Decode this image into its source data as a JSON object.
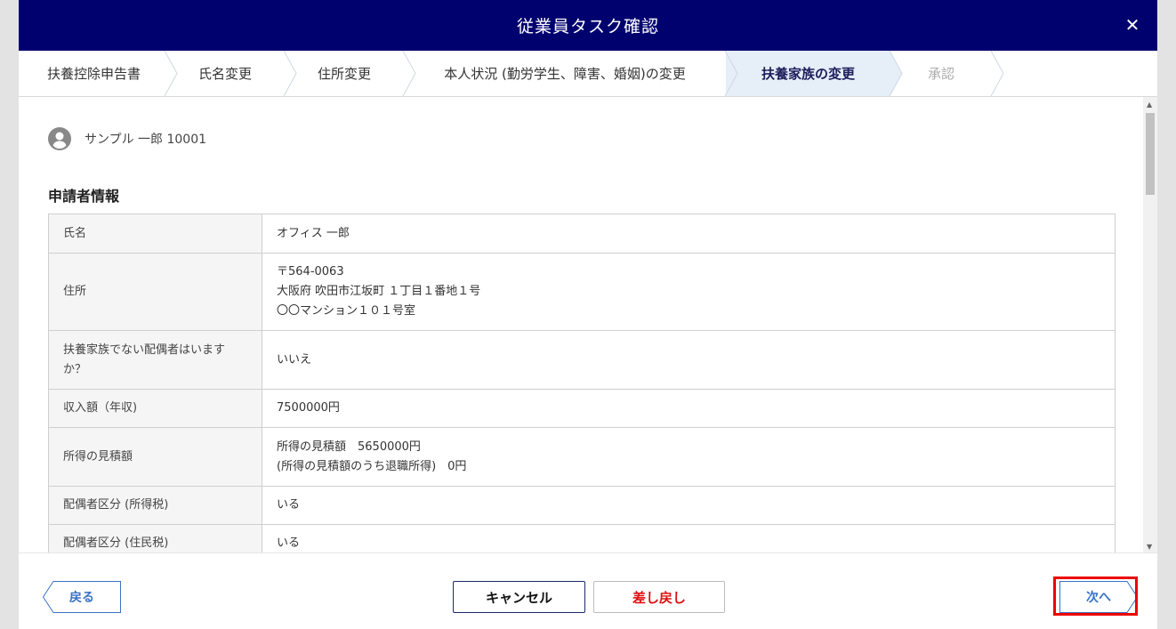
{
  "header": {
    "title": "従業員タスク確認",
    "close_glyph": "✕"
  },
  "steps": [
    {
      "label": "扶養控除申告書",
      "state": "done"
    },
    {
      "label": "氏名変更",
      "state": "done"
    },
    {
      "label": "住所変更",
      "state": "done"
    },
    {
      "label": "本人状況 (勤労学生、障害、婚姻)の変更",
      "state": "done"
    },
    {
      "label": "扶養家族の変更",
      "state": "active"
    },
    {
      "label": "承認",
      "state": "disabled"
    }
  ],
  "user": {
    "name": "サンプル 一郎 10001",
    "icon": "account-circle-icon"
  },
  "section_title": "申請者情報",
  "rows": [
    {
      "key": "氏名",
      "lines": [
        "オフィス 一郎"
      ]
    },
    {
      "key": "住所",
      "lines": [
        "〒564-0063",
        "大阪府 吹田市江坂町 １丁目１番地１号",
        "〇〇マンション１０１号室"
      ]
    },
    {
      "key_lines": [
        "扶養家族でない配偶者はいます",
        "か？"
      ],
      "lines": [
        "いいえ"
      ]
    },
    {
      "key": "収入額（年収)",
      "lines": [
        "7500000円"
      ]
    },
    {
      "key": "所得の見積額",
      "lines": [
        "所得の見積額　5650000円",
        "(所得の見積額のうち退職所得)　0円"
      ]
    },
    {
      "key": "配偶者区分 (所得税)",
      "lines": [
        "いる"
      ]
    },
    {
      "key": "配偶者区分 (住民税)",
      "lines": [
        "いる"
      ]
    }
  ],
  "footer": {
    "back_label": "戻る",
    "cancel_label": "キャンセル",
    "reject_label": "差し戻し",
    "next_label": "次へ"
  },
  "colors": {
    "header_bg": "#00006f",
    "active_step_bg": "#e6eef8",
    "reject_text": "#dd1111",
    "link_blue": "#3973c5",
    "highlight": "#ee0000"
  }
}
